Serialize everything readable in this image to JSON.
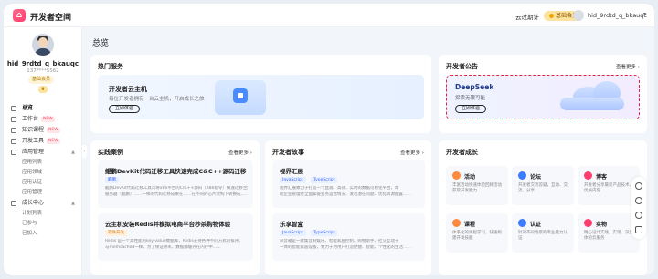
{
  "topbar": {
    "app_title": "开发者空间",
    "link_cloud": "云过期计",
    "vip_label": "基础会员",
    "user": "hid_9rdtd_q_bkauqc",
    "caret": "▾"
  },
  "sidebar": {
    "user_name": "hid_9rdtd_q_bkauqc",
    "user_phone": "137****5562",
    "member_tag": "基础会员",
    "items": [
      {
        "label": "总览",
        "active": true
      },
      {
        "label": "工作台",
        "tag": "NEW"
      },
      {
        "label": "知识课程",
        "tag": "NEW"
      },
      {
        "label": "开发工具",
        "tag": "NEW"
      },
      {
        "label": "应用管理"
      }
    ],
    "app_sub": [
      "应用列表",
      "应用领域",
      "应用认证",
      "应用管理"
    ],
    "growth_group": "成长中心",
    "growth_sub": [
      "计划列表",
      "已参与",
      "已加入"
    ],
    "collapse_arrow": "‹"
  },
  "main": {
    "page_title": "总览",
    "hot": {
      "title": "热门服务",
      "banner_title": "开发者云主机",
      "banner_desc": "每位开发者拥有一台云主机，开启成长之旅",
      "banner_button": "立即体验"
    },
    "announcement": {
      "title": "开发者公告",
      "more": "查看更多 ›",
      "banner_title": "DeepSeek",
      "banner_desc": "探索无限可能",
      "banner_button": "立即体验"
    },
    "practice": {
      "title": "实践案例",
      "more": "查看更多 ›",
      "cards": [
        {
          "title": "鲲鹏DevKit代码迁移工具快速完成C&C++源码迁移",
          "tag": "鲲鹏",
          "text1": "鲲鹏DevKit代码迁移工具可将x86平台的C/C++源码（X86指令）快速迁移至鲲鹏",
          "text2": "服务器（鲲鹏）……一样的代码迁移成果在……在不同的芯片架构下转换成……"
        },
        {
          "title": "云主机安装Redis并模拟电商平台秒杀购物体验",
          "tag": "软件开发",
          "text1": "Redis 是一个高性能的key-value数据库，Redis支持各种不同方式的排序。",
          "text2": "与memcached一样，为了保证效率，数据都缓存在内存中……"
        }
      ]
    },
    "story": {
      "title": "开发者故事",
      "more": "查看更多 ›",
      "cards": [
        {
          "title": "视界汇展",
          "tags": [
            "JavaScript",
            "TypeScript"
          ],
          "text1": "视界汇展致力于打造一个直观、高效、实时的数据可视化平台，帮",
          "text2": "助企业管理者全面掌握业务运营情况、发现潜在问题、优化资源配置……"
        },
        {
          "title": "乐享智盒",
          "tags": [
            "JavaScript",
            "TypeScript"
          ],
          "text1": "AI音箱是一款集音响娱乐、智能家居控制、购物助手、社交互动于",
          "text2": "一体的智能家居设备，致力于为用户打造便捷、智能、个性化的生活……"
        }
      ]
    },
    "growth": {
      "title": "开发者成长",
      "items": [
        {
          "name": "活动",
          "desc": "丰富活动快速体验回顾活动获取开发能力",
          "color": "#ff8a3d"
        },
        {
          "name": "论坛",
          "desc": "开发者交流答疑，互动、交流、分享",
          "color": "#3d7bff"
        },
        {
          "name": "博客",
          "desc": "开发者分享最新产品技术、优质内容",
          "color": "#ff3d6e"
        },
        {
          "name": "课程",
          "desc": "体系化的课程学习，快速构建开发技能",
          "color": "#ff8a3d"
        },
        {
          "name": "认证",
          "desc": "针对不同场景的专业能力认证",
          "color": "#3d7bff"
        },
        {
          "name": "实物",
          "desc": "精心设计实践，实现、深度体验云服务",
          "color": "#ff3d6e"
        }
      ]
    }
  },
  "float_bar": [
    "smile-icon",
    "share-icon",
    "phone-icon",
    "note-icon"
  ]
}
